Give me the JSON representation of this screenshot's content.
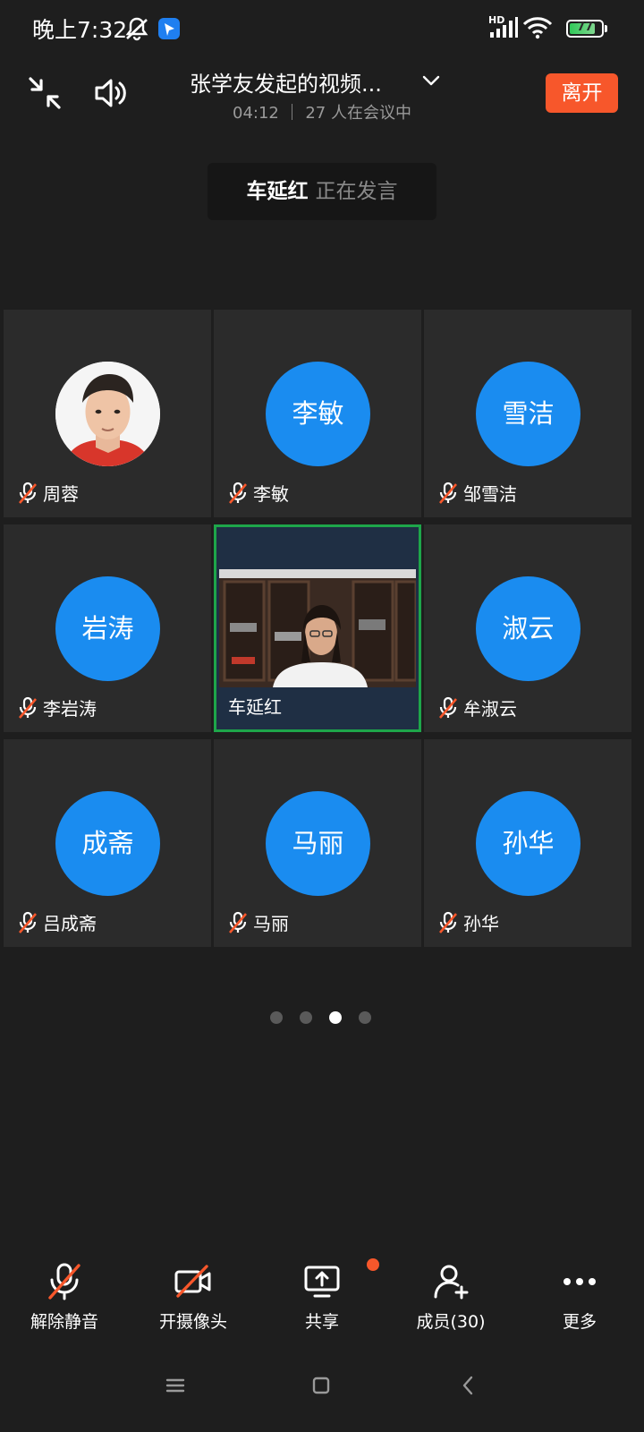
{
  "status_bar": {
    "time": "晚上7:32",
    "battery": "77",
    "network_label": "HD",
    "icons": [
      "bell-off-icon",
      "app-notification-icon",
      "signal-icon",
      "wifi-icon",
      "battery-icon"
    ]
  },
  "header": {
    "title": "张学友发起的视频...",
    "subtitle": "04:12 ｜ 27 人在会议中",
    "leave_label": "离开",
    "icons": [
      "minimize-icon",
      "speaker-icon",
      "chevron-down-icon"
    ]
  },
  "speaking": {
    "name": "车延红",
    "status": "正在发言"
  },
  "participants": [
    {
      "name": "周蓉",
      "avatar_text": "",
      "type": "photo",
      "muted": true
    },
    {
      "name": "李敏",
      "avatar_text": "李敏",
      "type": "initials",
      "muted": true
    },
    {
      "name": "邹雪洁",
      "avatar_text": "雪洁",
      "type": "initials",
      "muted": true
    },
    {
      "name": "李岩涛",
      "avatar_text": "岩涛",
      "type": "initials",
      "muted": true
    },
    {
      "name": "车延红",
      "avatar_text": "",
      "type": "video",
      "muted": false
    },
    {
      "name": "牟淑云",
      "avatar_text": "淑云",
      "type": "initials",
      "muted": true
    },
    {
      "name": "吕成斋",
      "avatar_text": "成斋",
      "type": "initials",
      "muted": true
    },
    {
      "name": "马丽",
      "avatar_text": "马丽",
      "type": "initials",
      "muted": true
    },
    {
      "name": "孙华",
      "avatar_text": "孙华",
      "type": "initials",
      "muted": true
    }
  ],
  "pagination": {
    "pages": 4,
    "current": 3
  },
  "toolbar": {
    "unmute_label": "解除静音",
    "camera_label": "开摄像头",
    "share_label": "共享",
    "members_label": "成员(30)",
    "more_label": "更多"
  },
  "colors": {
    "background": "#1e1e1e",
    "tile": "#2b2b2b",
    "avatar": "#1a8cf0",
    "leave": "#f7572b",
    "active_border": "#1ea64a"
  }
}
